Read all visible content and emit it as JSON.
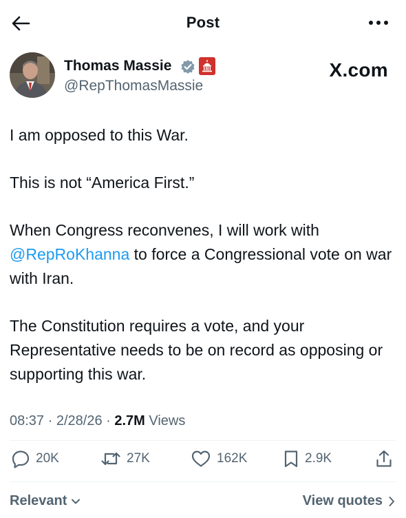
{
  "header": {
    "back_icon": "arrow-left-icon",
    "title": "Post",
    "more_icon": "more-horizontal-icon"
  },
  "author": {
    "name": "Thomas Massie",
    "handle": "@RepThomasMassie",
    "verified_icon": "verified-badge-icon",
    "affiliation_icon": "us-capitol-badge-icon",
    "verified_color": "#829aab",
    "affiliation_color": "#d0312d"
  },
  "watermark": "X.com",
  "tweet": {
    "p1": "I am opposed to this War.",
    "p2": "This is not “America First.”",
    "p3_before": "When Congress reconvenes, I will work with ",
    "p3_mention": "@RepRoKhanna",
    "p3_after": " to force a Congressional vote on war with Iran.",
    "p4": "The Constitution requires a vote, and your Representative needs to be on record as opposing or supporting this war."
  },
  "meta": {
    "time": "08:37",
    "sep1": " · ",
    "date": "2/28/26",
    "sep2": " · ",
    "views_count": "2.7M",
    "views_label": " Views"
  },
  "actions": {
    "replies": "20K",
    "reposts": "27K",
    "likes": "162K",
    "bookmarks": "2.9K"
  },
  "footer": {
    "relevant_label": "Relevant",
    "view_quotes_label": "View quotes"
  },
  "colors": {
    "text": "#0f1419",
    "secondary": "#536471",
    "link": "#1d9bf0",
    "divider": "#eff3f4"
  }
}
